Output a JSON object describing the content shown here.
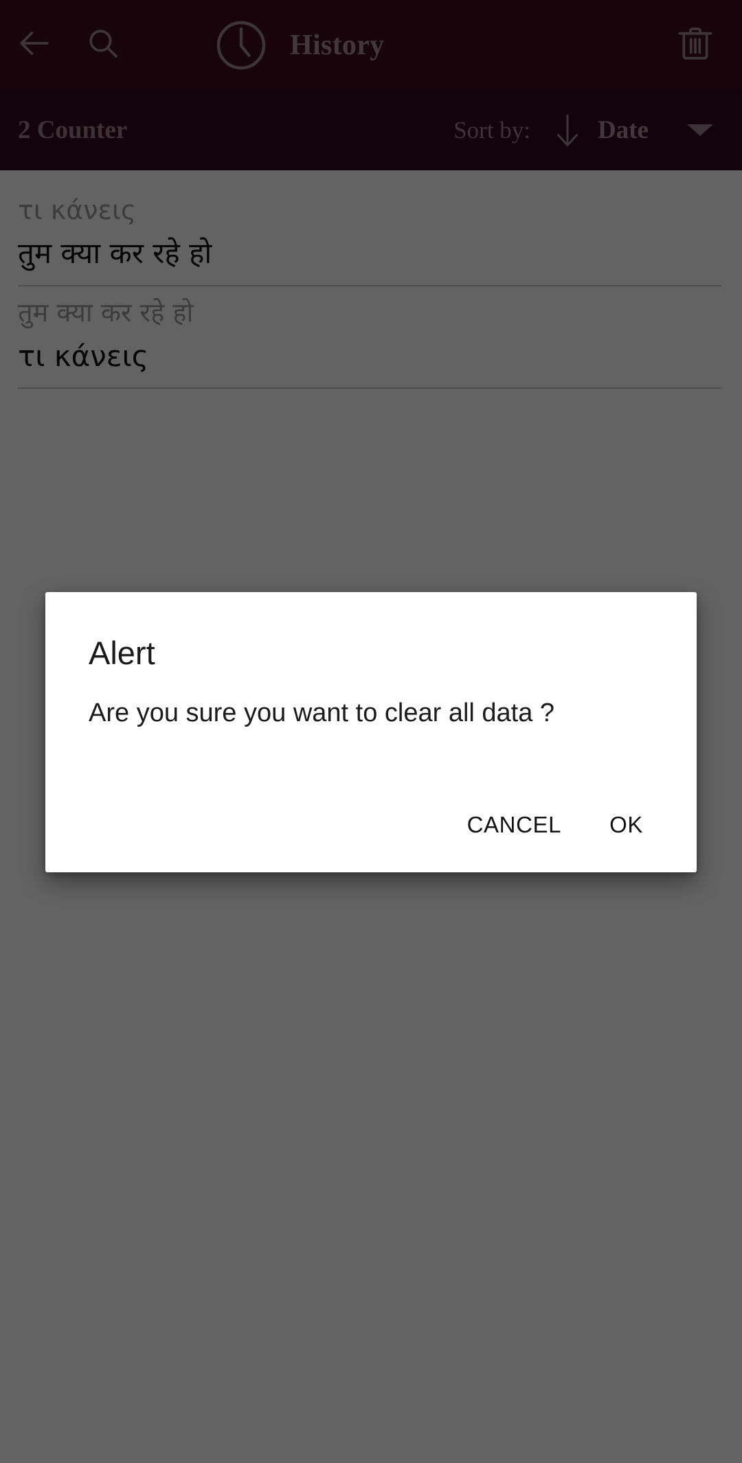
{
  "app_bar": {
    "back_icon": "arrow-left-icon",
    "search_icon": "search-icon",
    "clock_icon": "clock-icon",
    "title": "History",
    "delete_icon": "trash-icon",
    "background_color": "#3b0e1d",
    "foreground_color": "#a98f96"
  },
  "sort_bar": {
    "counter_label": "2 Counter",
    "sort_by_label": "Sort by:",
    "sort_direction_icon": "arrow-down-icon",
    "sort_field": "Date",
    "dropdown_icon": "chevron-down-icon",
    "background_color": "#33091a"
  },
  "history": {
    "items": [
      {
        "source_text": "τι κάνεις",
        "target_text": "तुम क्या कर रहे हो"
      },
      {
        "source_text": "तुम क्या कर रहे हो",
        "target_text": "τι κάνεις"
      }
    ]
  },
  "dialog": {
    "title": "Alert",
    "message": "Are you sure you want to clear all data ?",
    "cancel_label": "CANCEL",
    "ok_label": "OK",
    "background_color": "#ffffff"
  },
  "scrim": {
    "color": "#000000",
    "opacity": "0.61"
  }
}
